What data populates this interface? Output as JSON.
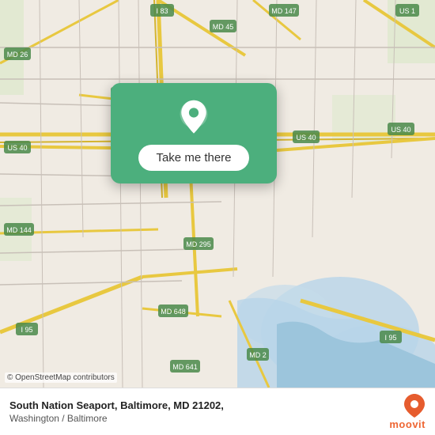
{
  "map": {
    "attribution": "© OpenStreetMap contributors",
    "background_color": "#e8e0d8"
  },
  "popup": {
    "button_label": "Take me there",
    "pin_color": "#ffffff"
  },
  "info_bar": {
    "location_name": "South Nation Seaport, Baltimore, MD 21202,",
    "location_sub": "Washington / Baltimore",
    "logo_text": "moovit"
  }
}
